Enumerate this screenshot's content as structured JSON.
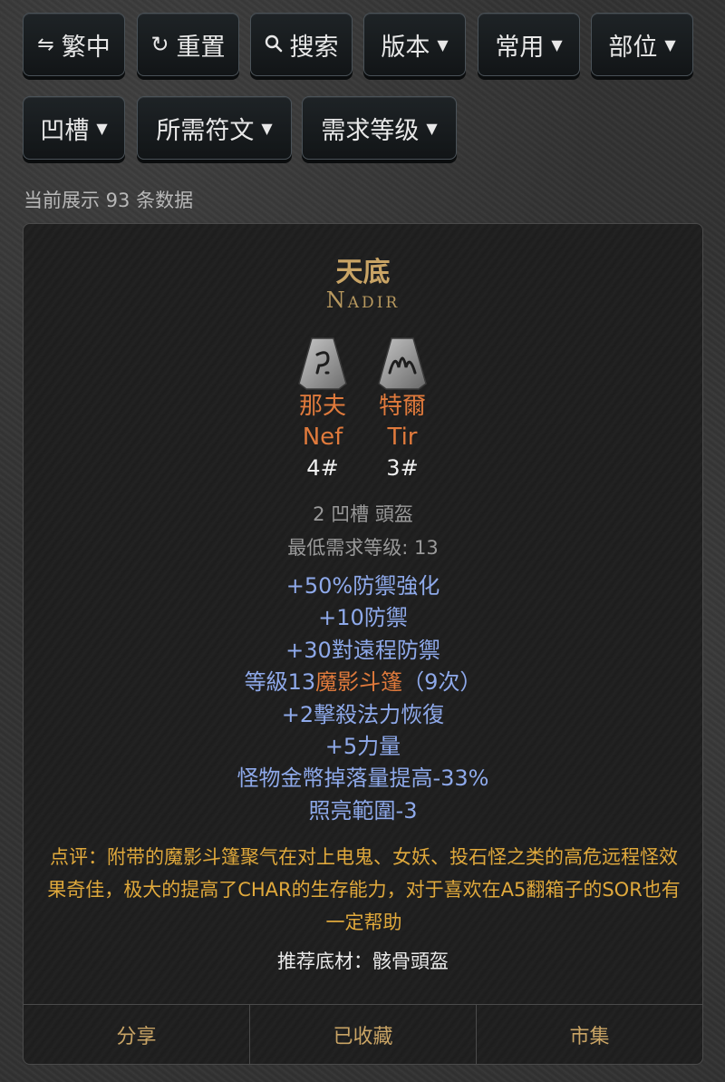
{
  "toolbar": {
    "row1": [
      {
        "icon": "⇋",
        "label": "繁中",
        "caret": false
      },
      {
        "icon": "↻",
        "label": "重置",
        "caret": false
      },
      {
        "icon": "⚲",
        "label": "搜索",
        "caret": false
      },
      {
        "icon": "",
        "label": "版本",
        "caret": true
      },
      {
        "icon": "",
        "label": "常用",
        "caret": true
      },
      {
        "icon": "",
        "label": "部位",
        "caret": true
      }
    ],
    "row2": [
      {
        "label": "凹槽",
        "caret": true
      },
      {
        "label": "所需符文",
        "caret": true
      },
      {
        "label": "需求等级",
        "caret": true
      }
    ],
    "caret_glyph": "▼"
  },
  "result_count": "当前展示 93 条数据",
  "item": {
    "name_cn": "天底",
    "name_en": "Nadir",
    "runes": [
      {
        "cn": "那夫",
        "en": "Nef",
        "num": "4#"
      },
      {
        "cn": "特爾",
        "en": "Tir",
        "num": "3#"
      }
    ],
    "socket_info": "2 凹槽 頭盔",
    "min_level": "最低需求等级: 13",
    "stats_before": [
      "+50%防禦強化",
      "+10防禦",
      "+30對遠程防禦"
    ],
    "skill_stat": {
      "prefix": "等級13",
      "skill": "魔影斗篷",
      "suffix": "（9次）"
    },
    "stats_after": [
      "+2擊殺法力恢復",
      "+5力量",
      "怪物金幣掉落量提高-33%",
      "照亮範圍-3"
    ],
    "comment": "点评：附带的魔影斗篷聚气在对上电鬼、女妖、投石怪之类的高危远程怪效果奇佳，极大的提高了CHAR的生存能力，对于喜欢在A5翻箱子的SOR也有一定帮助",
    "recommend": "推荐底材：骸骨頭盔"
  },
  "footer": {
    "share": "分享",
    "favorited": "已收藏",
    "market": "市集"
  },
  "colors": {
    "gold": "#c9a465",
    "rune": "#e07a3c",
    "stat": "#8ea9ea",
    "comment": "#e0a93c"
  }
}
